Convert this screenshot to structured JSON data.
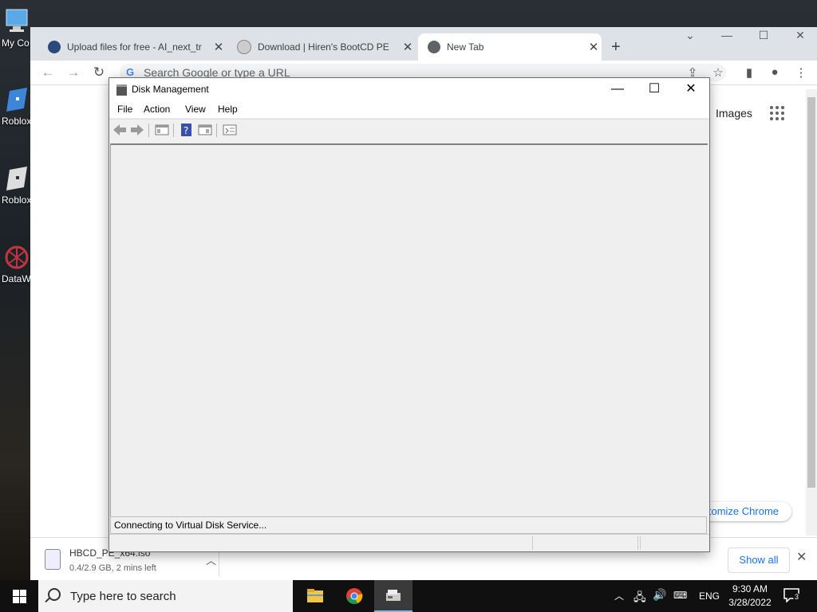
{
  "desktop": {
    "icons": [
      {
        "label": "My Co"
      },
      {
        "label": "Roblox"
      },
      {
        "label": "Roblox"
      },
      {
        "label": "DataW"
      }
    ]
  },
  "browser": {
    "tabs": [
      {
        "title": "Upload files for free - AI_next_tr"
      },
      {
        "title": "Download | Hiren's BootCD PE"
      },
      {
        "title": "New Tab"
      }
    ],
    "omnibox_placeholder": "Search Google or type a URL",
    "images_link": "Images",
    "customize_label": "tomize Chrome"
  },
  "download_bar": {
    "file_name": "HBCD_PE_x64.iso",
    "status": "0.4/2.9 GB, 2 mins left",
    "show_all": "Show all"
  },
  "disk_management": {
    "title": "Disk Management",
    "menu": [
      "File",
      "Action",
      "View",
      "Help"
    ],
    "status_text": "Connecting to Virtual Disk Service..."
  },
  "taskbar": {
    "search_placeholder": "Type here to search",
    "language": "ENG",
    "time": "9:30 AM",
    "date": "3/28/2022",
    "notification_count": "3"
  },
  "colors": {
    "chrome_tabstrip": "#dee1e6",
    "link_blue": "#1a73e8",
    "taskbar": "#101010"
  }
}
